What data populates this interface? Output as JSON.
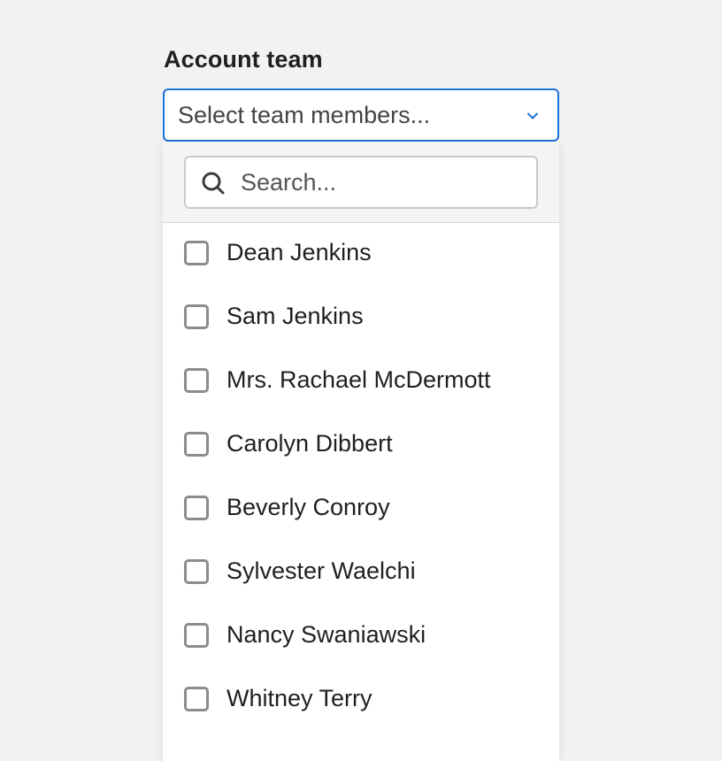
{
  "field": {
    "label": "Account team",
    "placeholder": "Select team members..."
  },
  "search": {
    "placeholder": "Search...",
    "value": ""
  },
  "options": [
    {
      "label": "Dean Jenkins",
      "checked": false
    },
    {
      "label": "Sam Jenkins",
      "checked": false
    },
    {
      "label": "Mrs. Rachael McDermott",
      "checked": false
    },
    {
      "label": "Carolyn Dibbert",
      "checked": false
    },
    {
      "label": "Beverly Conroy",
      "checked": false
    },
    {
      "label": "Sylvester Waelchi",
      "checked": false
    },
    {
      "label": "Nancy Swaniawski",
      "checked": false
    },
    {
      "label": "Whitney Terry",
      "checked": false
    }
  ],
  "colors": {
    "accent": "#1a73d9",
    "background": "#f2f2f2",
    "checkbox_border": "#8c8c8c"
  },
  "icons": {
    "trigger": "chevron-down-icon",
    "search": "search-icon",
    "option": "checkbox"
  }
}
